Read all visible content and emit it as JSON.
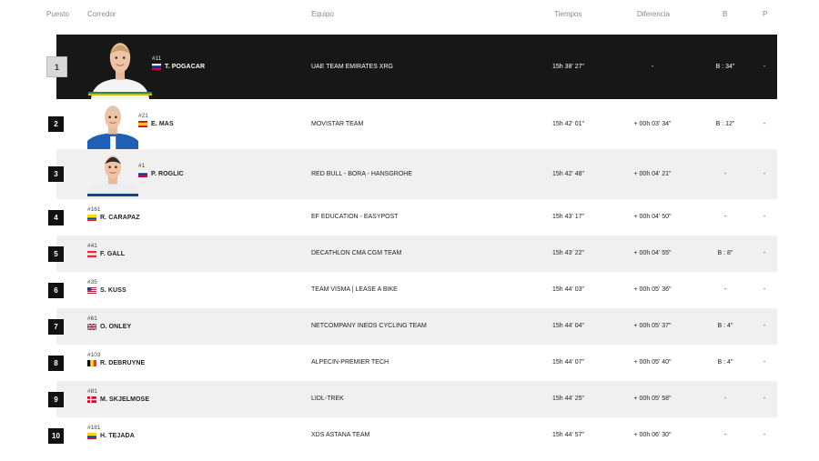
{
  "columns": {
    "puesto": "Puesto",
    "corredor": "Corredor",
    "equipo": "Equipo",
    "tiempos": "Tiempos",
    "diferencia": "Diferencia",
    "b": "B",
    "p": "P"
  },
  "rows": [
    {
      "pos": "1",
      "num": "#11",
      "name": "T. POGACAR",
      "flag": "SVN",
      "team": "UAE TEAM EMIRATES XRG",
      "time": "15h 38' 27\"",
      "diff": "-",
      "bonus": "B : 34\"",
      "points": "-"
    },
    {
      "pos": "2",
      "num": "#21",
      "name": "E. MAS",
      "flag": "ESP",
      "team": "MOVISTAR TEAM",
      "time": "15h 42' 01\"",
      "diff": "+ 00h 03' 34\"",
      "bonus": "B : 12\"",
      "points": "-"
    },
    {
      "pos": "3",
      "num": "#1",
      "name": "P. ROGLIC",
      "flag": "SVN",
      "team": "RED BULL - BORA - HANSGROHE",
      "time": "15h 42' 48\"",
      "diff": "+ 00h 04' 21\"",
      "bonus": "-",
      "points": "-"
    },
    {
      "pos": "4",
      "num": "#161",
      "name": "R. CARAPAZ",
      "flag": "ECU",
      "team": "EF EDUCATION - EASYPOST",
      "time": "15h 43' 17\"",
      "diff": "+ 00h 04' 50\"",
      "bonus": "-",
      "points": "-"
    },
    {
      "pos": "5",
      "num": "#41",
      "name": "F. GALL",
      "flag": "AUT",
      "team": "DECATHLON CMA CGM TEAM",
      "time": "15h 43' 22\"",
      "diff": "+ 00h 04' 55\"",
      "bonus": "B : 8\"",
      "points": "-"
    },
    {
      "pos": "6",
      "num": "#35",
      "name": "S. KUSS",
      "flag": "USA",
      "team": "TEAM VISMA | LEASE A BIKE",
      "time": "15h 44' 03\"",
      "diff": "+ 00h 05' 36\"",
      "bonus": "-",
      "points": "-"
    },
    {
      "pos": "7",
      "num": "#61",
      "name": "O. ONLEY",
      "flag": "GBR",
      "team": "NETCOMPANY INEOS CYCLING TEAM",
      "time": "15h 44' 04\"",
      "diff": "+ 00h 05' 37\"",
      "bonus": "B : 4\"",
      "points": "-"
    },
    {
      "pos": "8",
      "num": "#103",
      "name": "R. DEBRUYNE",
      "flag": "BEL",
      "team": "ALPECIN-PREMIER TECH",
      "time": "15h 44' 07\"",
      "diff": "+ 00h 05' 40\"",
      "bonus": "B : 4\"",
      "points": "-"
    },
    {
      "pos": "9",
      "num": "#81",
      "name": "M. SKJELMOSE",
      "flag": "DNK",
      "team": "LIDL-TREK",
      "time": "15h 44' 25\"",
      "diff": "+ 00h 05' 58\"",
      "bonus": "-",
      "points": "-"
    },
    {
      "pos": "10",
      "num": "#181",
      "name": "H. TEJADA",
      "flag": "COL",
      "team": "XDS ASTANA TEAM",
      "time": "15h 44' 57\"",
      "diff": "+ 00h 06' 30\"",
      "bonus": "-",
      "points": "-"
    }
  ]
}
